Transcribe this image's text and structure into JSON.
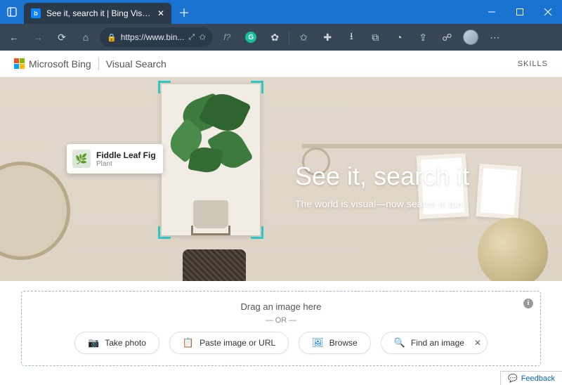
{
  "window": {
    "tab_title": "See it, search it | Bing Visual Sea"
  },
  "toolbar": {
    "url": "https://www.bin..."
  },
  "header": {
    "brand": "Microsoft Bing",
    "subbrand": "Visual Search",
    "skills": "SKILLS"
  },
  "hero": {
    "callout_title": "Fiddle Leaf Fig",
    "callout_subtitle": "Plant",
    "title": "See it, search it",
    "subtitle": "The world is visual—now search is too"
  },
  "dropzone": {
    "title": "Drag an image here",
    "or": "— OR —",
    "take_photo": "Take photo",
    "paste": "Paste image or URL",
    "browse": "Browse",
    "find": "Find an image"
  },
  "feedback": {
    "label": "Feedback"
  }
}
